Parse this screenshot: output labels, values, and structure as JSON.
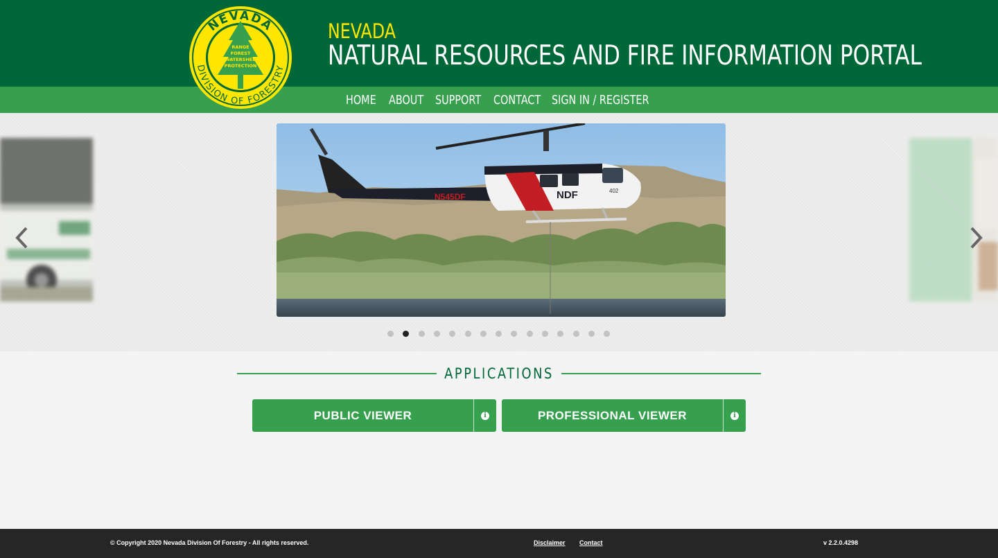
{
  "header": {
    "title_small": "NEVADA",
    "title_big": "NATURAL RESOURCES AND FIRE INFORMATION PORTAL",
    "logo": {
      "top_text": "NEVADA",
      "ring_text": "DIVISION OF FORESTRY",
      "tree_lines": [
        "RANGE",
        "FOREST",
        "WATERSHED",
        "PROTECTION"
      ]
    }
  },
  "nav": {
    "items": [
      {
        "label": "HOME"
      },
      {
        "label": "ABOUT"
      },
      {
        "label": "SUPPORT"
      },
      {
        "label": "CONTACT"
      },
      {
        "label": "SIGN IN / REGISTER"
      }
    ]
  },
  "carousel": {
    "slide_count": 15,
    "active_index": 1,
    "main_slide": {
      "tail_number": "N545DF",
      "body_text": "NDF",
      "nose_number": "402"
    }
  },
  "applications": {
    "heading": "APPLICATIONS",
    "buttons": [
      {
        "label": "PUBLIC VIEWER",
        "info_icon": "info-icon"
      },
      {
        "label": "PROFESSIONAL VIEWER",
        "info_icon": "info-icon"
      }
    ]
  },
  "footer": {
    "copyright": "© Copyright 2020 Nevada Division Of Forestry - All rights reserved.",
    "disclaimer": "Disclaimer",
    "contact": "Contact",
    "version": "v 2.2.0.4298"
  },
  "colors": {
    "header_dark": "#006838",
    "header_nav": "#37a04f",
    "title_yellow": "#ffe600",
    "footer_bg": "#262626"
  }
}
